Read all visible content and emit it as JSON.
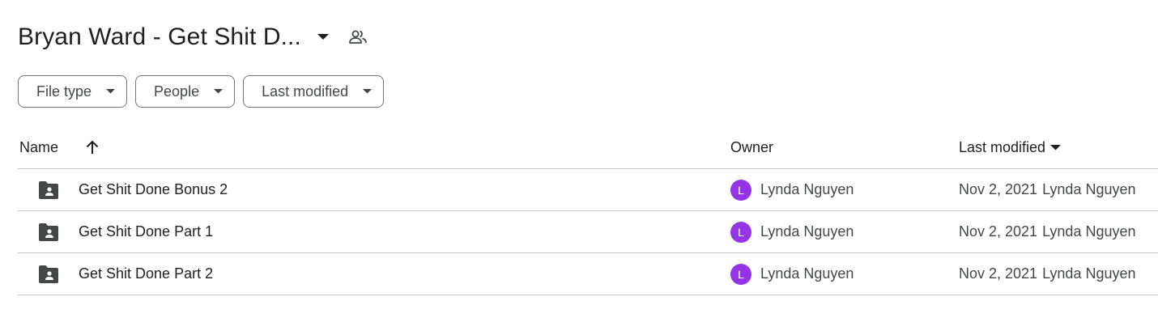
{
  "header": {
    "title": "Bryan Ward - Get Shit D...",
    "dropdown_icon": "arrow-drop-down-icon",
    "share_icon": "shared-people-icon"
  },
  "filters": {
    "file_type": "File type",
    "people": "People",
    "last_modified": "Last modified"
  },
  "table": {
    "columns": {
      "name": "Name",
      "owner": "Owner",
      "last_modified": "Last modified"
    },
    "sort": {
      "name_sort_icon": "arrow-upward-icon",
      "modified_sort_icon": "arrow-drop-down-icon"
    },
    "rows": [
      {
        "name": "Get Shit Done Bonus 2",
        "icon": "shared-folder-icon",
        "owner_initial": "L",
        "owner": "Lynda Nguyen",
        "modified_date": "Nov 2, 2021",
        "modified_by": "Lynda Nguyen"
      },
      {
        "name": "Get Shit Done Part 1",
        "icon": "shared-folder-icon",
        "owner_initial": "L",
        "owner": "Lynda Nguyen",
        "modified_date": "Nov 2, 2021",
        "modified_by": "Lynda Nguyen"
      },
      {
        "name": "Get Shit Done Part 2",
        "icon": "shared-folder-icon",
        "owner_initial": "L",
        "owner": "Lynda Nguyen",
        "modified_date": "Nov 2, 2021",
        "modified_by": "Lynda Nguyen"
      }
    ]
  },
  "colors": {
    "avatar": "#9334e6",
    "folder_icon": "#444746",
    "divider": "#c7c7c7",
    "chip_border": "#747775"
  }
}
